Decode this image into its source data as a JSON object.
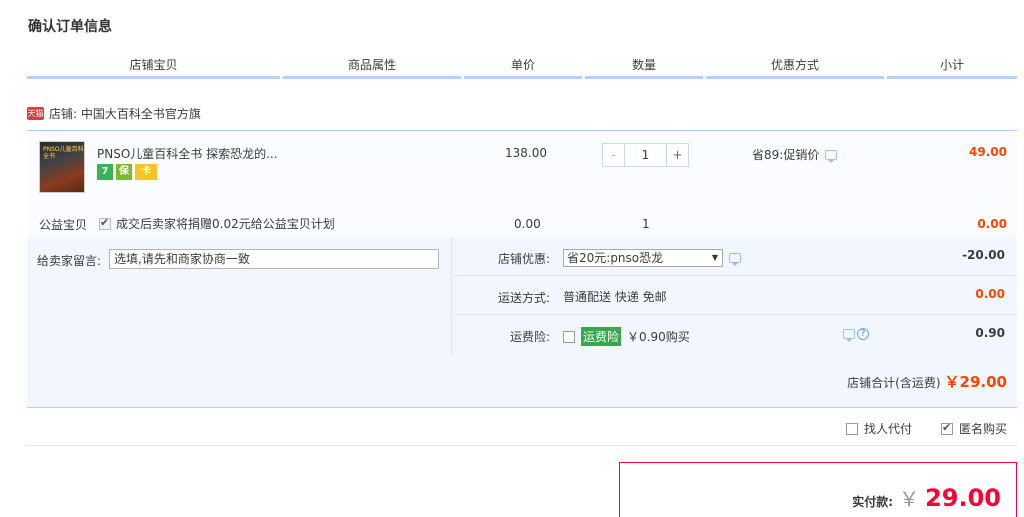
{
  "page": {
    "title": "确认订单信息"
  },
  "table_header": {
    "columns": [
      "店铺宝贝",
      "商品属性",
      "单价",
      "数量",
      "优惠方式",
      "小计"
    ]
  },
  "shop": {
    "tmall_badge": "天猫",
    "label": "店铺: 中国大百科全书官方旗"
  },
  "item": {
    "thumb_text": "PNSO儿童百科全书",
    "title": "PNSO儿童百科全书 探索恐龙的...",
    "badges": [
      "7",
      "保",
      "卡"
    ],
    "unit_price": "138.00",
    "quantity": "1",
    "qty_minus": "-",
    "qty_plus": "+",
    "promo": "省89:促销价",
    "subtotal": "49.00"
  },
  "charity": {
    "label": "公益宝贝",
    "text": "成交后卖家将捐赠0.02元给公益宝贝计划",
    "checked": true,
    "price": "0.00",
    "quantity": "1",
    "subtotal": "0.00"
  },
  "message": {
    "label": "给卖家留言:",
    "placeholder": "选填,请先和商家协商一致"
  },
  "options": {
    "coupon": {
      "label": "店铺优惠:",
      "selected": "省20元:pnso恐龙",
      "amount": "-20.00"
    },
    "shipping": {
      "label": "运送方式:",
      "value": "普通配送 快递 免邮",
      "amount": "0.00"
    },
    "insurance": {
      "label": "运费险:",
      "tag": "运费险",
      "price": "￥0.90购买",
      "amount": "0.90",
      "help": "?"
    }
  },
  "shop_total": {
    "label": "店铺合计(含运费)",
    "amount": "￥29.00"
  },
  "extras": {
    "proxy_pay": "找人代付",
    "anonymous": "匿名购买"
  },
  "payment": {
    "label": "实付款:",
    "currency": "￥",
    "amount": "29.00"
  },
  "colors": {
    "accent_blue": "#b2d1ff",
    "price_red": "#ff4400",
    "pay_red": "#ff0036",
    "insurance_green": "#35a84a"
  }
}
